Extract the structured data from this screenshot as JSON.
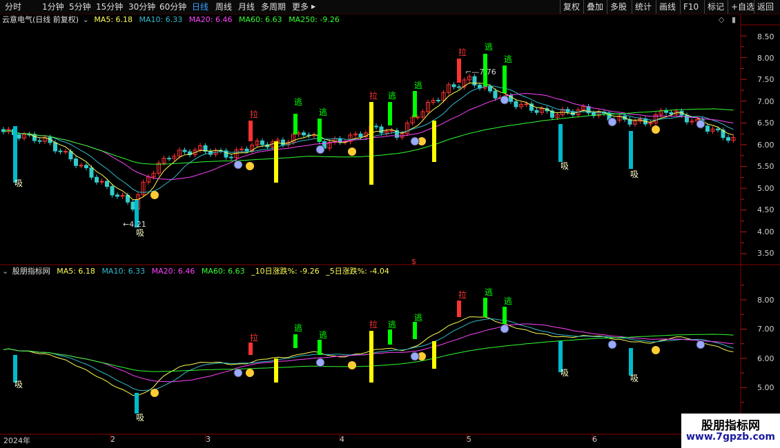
{
  "toolbar": {
    "periods": [
      "分时",
      "1分钟",
      "5分钟",
      "15分钟",
      "30分钟",
      "60分钟",
      "日线",
      "周线",
      "月线",
      "多周期",
      "更多"
    ],
    "active_period": "日线",
    "more_arrow": "▶",
    "tools": [
      "复权",
      "叠加",
      "多股",
      "统计",
      "画线",
      "F10",
      "标记",
      "+自选",
      "返回"
    ]
  },
  "main_panel": {
    "title": "云意电气(日线 前复权)",
    "indicators": [
      {
        "label": "MA5: 6.18",
        "color": "#ffff55"
      },
      {
        "label": "MA10: 6.33",
        "color": "#33bbcc"
      },
      {
        "label": "MA20: 6.46",
        "color": "#ff44ff"
      },
      {
        "label": "MA60: 6.63",
        "color": "#33ff33"
      },
      {
        "label": "MA250: -9.26",
        "color": "#33ff33"
      }
    ],
    "y_ticks": [
      "8.50",
      "8.00",
      "7.50",
      "7.00",
      "6.50",
      "6.00",
      "5.50",
      "5.00",
      "4.50",
      "4.00",
      "3.50"
    ],
    "low_marker": "4.21",
    "high_marker": "7.76",
    "dollar_marker": "$"
  },
  "sub_panel": {
    "title": "股朋指标网",
    "indicators": [
      {
        "label": "MA5: 6.18",
        "color": "#ffff55"
      },
      {
        "label": "MA10: 6.33",
        "color": "#33bbcc"
      },
      {
        "label": "MA20: 6.46",
        "color": "#ff44ff"
      },
      {
        "label": "MA60: 6.63",
        "color": "#33ff33"
      },
      {
        "label": "_10日涨跌%: -9.26",
        "color": "#ffff55"
      },
      {
        "label": "_5日涨跌%: -4.04",
        "color": "#ffff55"
      }
    ],
    "y_ticks": [
      "8.00",
      "7.00",
      "6.00",
      "5.00"
    ]
  },
  "signals": {
    "buy": "吸",
    "escape": "逃",
    "pull": "拉"
  },
  "x_axis": {
    "labels": [
      "2024年",
      "2",
      "3",
      "4",
      "5",
      "6"
    ]
  },
  "watermark": {
    "line1": "股朋指标网",
    "line2": "www.7gpzb.com"
  },
  "colors": {
    "up": "#ff3232",
    "down": "#33cccc",
    "ma5": "#ffff55",
    "ma10": "#33bbcc",
    "ma20": "#ff44ff",
    "ma60": "#33ff33",
    "grid": "#8b0000"
  }
}
